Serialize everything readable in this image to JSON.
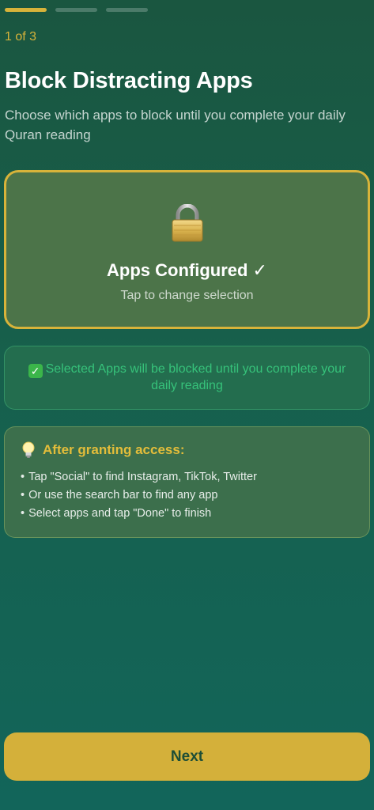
{
  "progress": {
    "current": 1,
    "total": 3
  },
  "step_label": "1 of 3",
  "title": "Block Distracting Apps",
  "subtitle": "Choose which apps to block until you complete your daily Quran reading",
  "config_card": {
    "icon": "lock-icon",
    "title": "Apps Configured ✓",
    "subtitle": "Tap to change selection"
  },
  "info_card": {
    "icon": "check-box-icon",
    "text": "Selected Apps will be blocked until you complete your daily reading"
  },
  "tips_card": {
    "icon": "lightbulb-icon",
    "heading": "After granting access:",
    "items": [
      "Tap \"Social\" to find Instagram, TikTok, Twitter",
      "Or use the search bar to find any app",
      "Select apps and tap \"Done\" to finish"
    ]
  },
  "next_button": {
    "label": "Next"
  },
  "colors": {
    "accent": "#d7b33a",
    "success": "#36c27a",
    "background_top": "#1a5640",
    "background_bottom": "#12655a"
  }
}
